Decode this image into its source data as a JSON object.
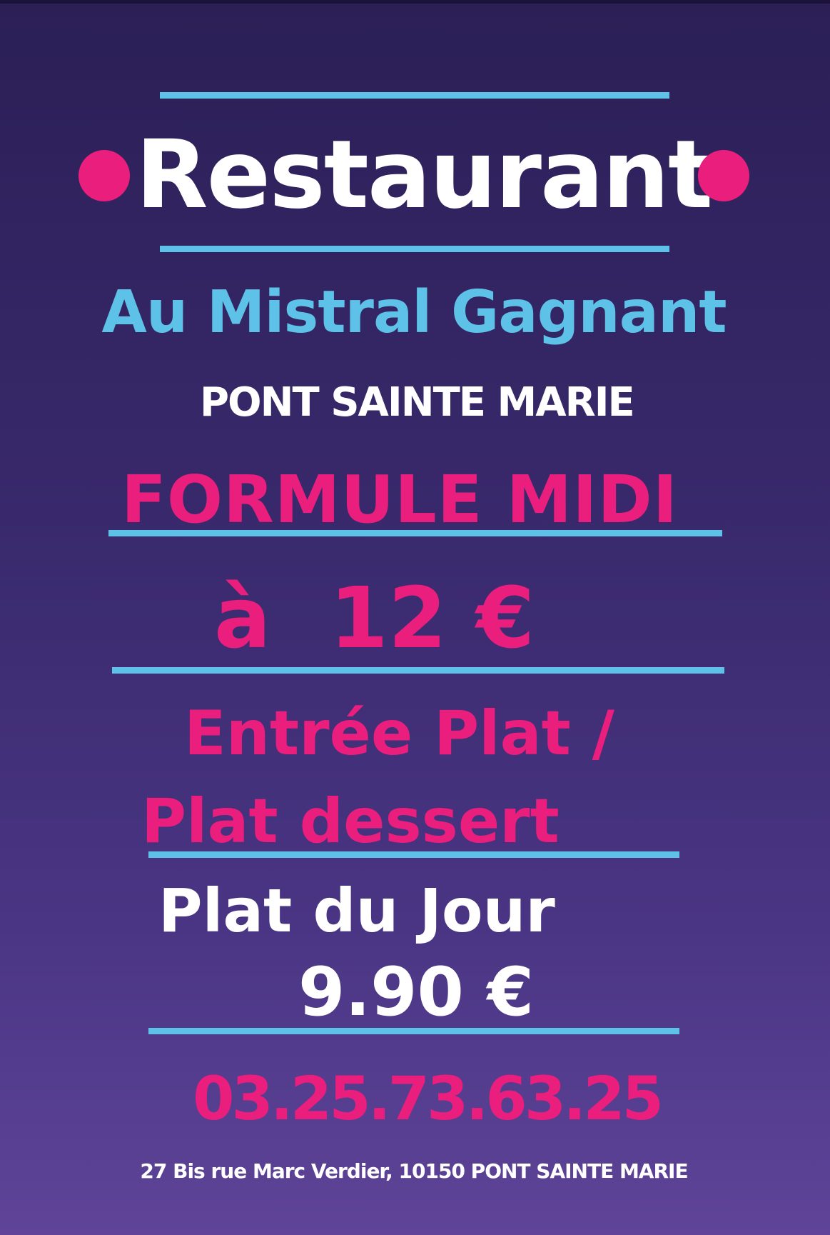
{
  "flyer": {
    "title": "Restaurant",
    "name": "Au Mistral Gagnant",
    "town": "PONT SAINTE MARIE",
    "offer_title": "FORMULE MIDI",
    "offer_price": "à  12 €",
    "menu_line_1": "Entrée Plat /",
    "menu_line_2": "Plat dessert",
    "daily_label": "Plat du Jour",
    "daily_price": "9.90 €",
    "phone": "03.25.73.63.25",
    "address": "27 Bis rue Marc Verdier, 10150 PONT SAINTE MARIE"
  },
  "colors": {
    "background_top": "#2b1f56",
    "background_bottom": "#5f4498",
    "pink": "#ea1e7c",
    "blue": "#5ec2e8",
    "white": "#ffffff"
  }
}
